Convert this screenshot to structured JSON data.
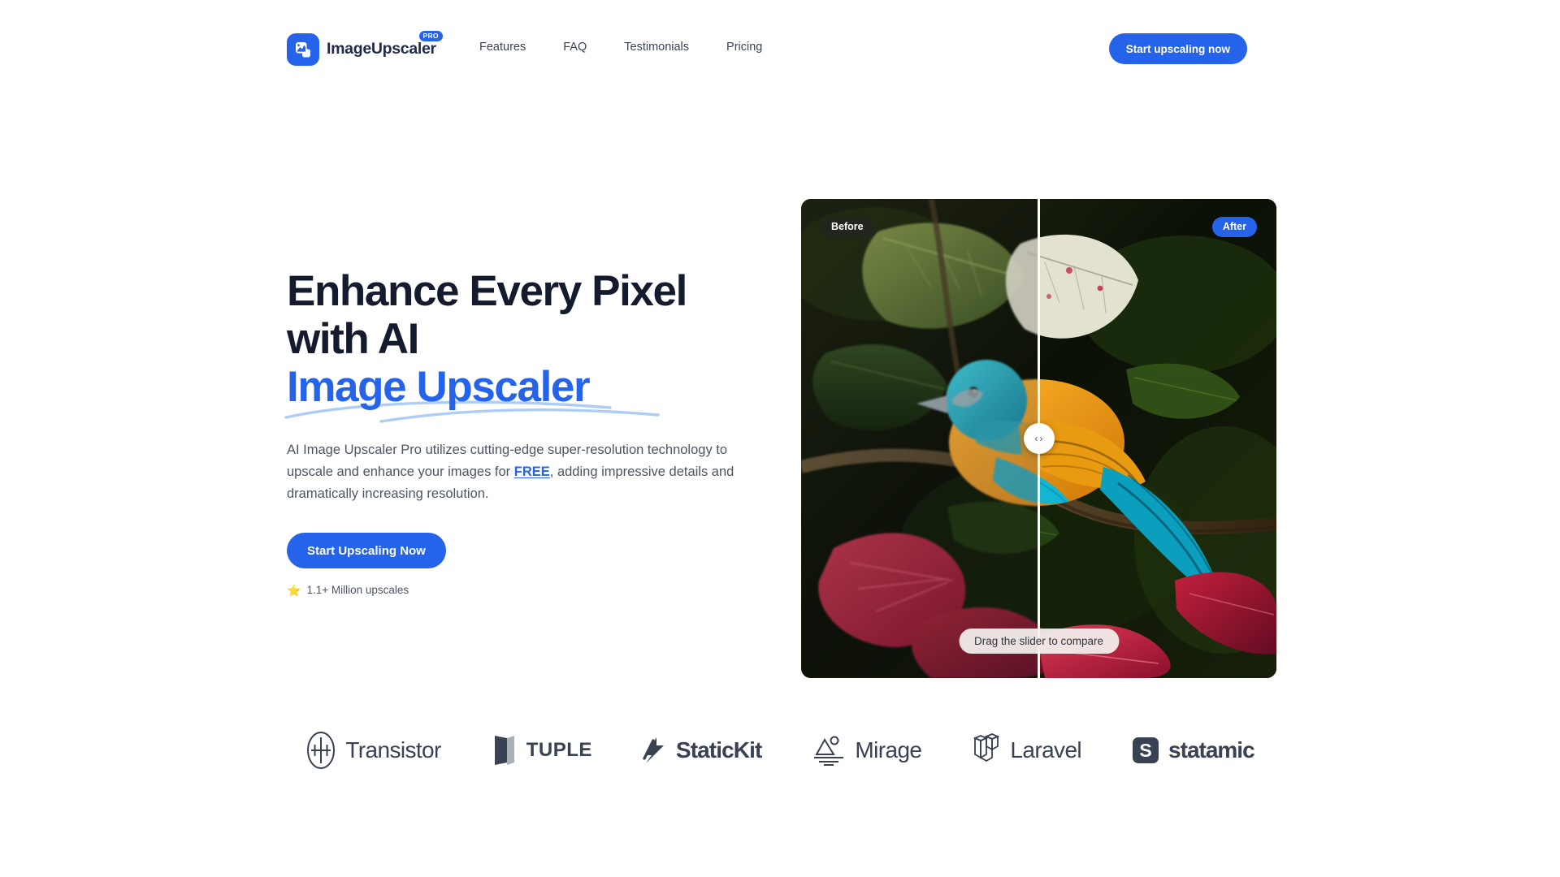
{
  "header": {
    "brand_name": "ImageUpscaler",
    "brand_badge": "PRO",
    "logo_icon": "image-mountain-icon",
    "nav_items": [
      {
        "label": "Features"
      },
      {
        "label": "FAQ"
      },
      {
        "label": "Testimonials"
      },
      {
        "label": "Pricing"
      }
    ],
    "cta_label": "Start upscaling now"
  },
  "hero": {
    "headline_line1": "Enhance Every Pixel",
    "headline_line2": "with AI",
    "headline_accent": "Image Upscaler",
    "desc_part1": "AI Image Upscaler Pro utilizes cutting-edge super-resolution technology to upscale and enhance your images for ",
    "desc_link": "FREE",
    "desc_part2": ", adding impressive details and dramatically increasing resolution.",
    "cta_label": "Start Upscaling Now",
    "rating_icon": "star-icon",
    "rating_star": "⭐",
    "rating_text": "1.1+ Million upscales"
  },
  "compare": {
    "before_label": "Before",
    "after_label": "After",
    "tooltip": "Drag the slider to compare",
    "handle_left_icon": "chevron-left-icon",
    "handle_right_icon": "chevron-right-icon",
    "handle_left_glyph": "‹",
    "handle_right_glyph": "›",
    "slider_position_percent": 50
  },
  "logos": [
    {
      "name": "Transistor",
      "icon": "transistor-icon"
    },
    {
      "name": "TUPLE",
      "icon": "tuple-icon"
    },
    {
      "name": "StaticKit",
      "icon": "statickit-icon"
    },
    {
      "name": "Mirage",
      "icon": "mirage-icon"
    },
    {
      "name": "Laravel",
      "icon": "laravel-icon"
    },
    {
      "name": "statamic",
      "icon": "statamic-icon"
    }
  ],
  "colors": {
    "brand_blue": "#2563eb",
    "headline_navy": "#141b2e",
    "body_gray": "#4b5563",
    "logo_slate": "#384252",
    "swoosh_blue": "#aecdf4"
  }
}
